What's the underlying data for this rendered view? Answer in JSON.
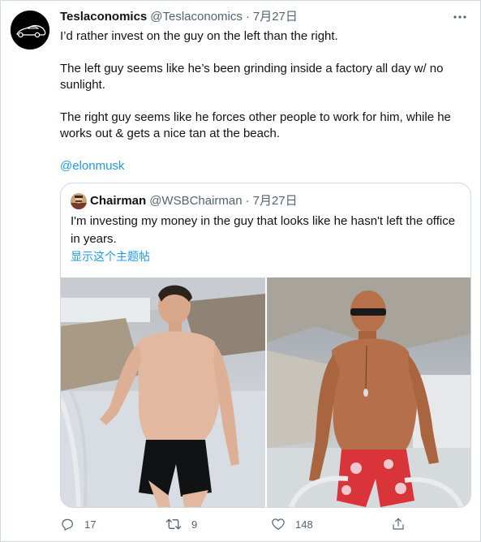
{
  "tweet": {
    "author_name": "Teslaconomics",
    "author_handle": "@Teslaconomics",
    "separator": "·",
    "date": "7月27日",
    "more_icon": "more-horizontal-icon",
    "paragraphs": [
      "I’d rather invest on the guy on the left than the right.",
      "The left guy seems like he’s been grinding inside a factory all day w/ no sunlight.",
      "The right guy seems like he forces other people to work for him, while he works out & gets a nice tan at the beach."
    ],
    "mention": "@elonmusk"
  },
  "quote": {
    "author_name": "Chairman",
    "author_handle": "@WSBChairman",
    "separator": "·",
    "date": "7月27日",
    "text": "I'm investing my money in the guy that looks like he hasn't left the office in years.",
    "show_thread": "显示这个主题帖"
  },
  "actions": {
    "reply_count": "17",
    "retweet_count": "9",
    "like_count": "148"
  },
  "colors": {
    "link": "#1d9bf0",
    "muted": "#536471",
    "border": "#cfd9de"
  }
}
